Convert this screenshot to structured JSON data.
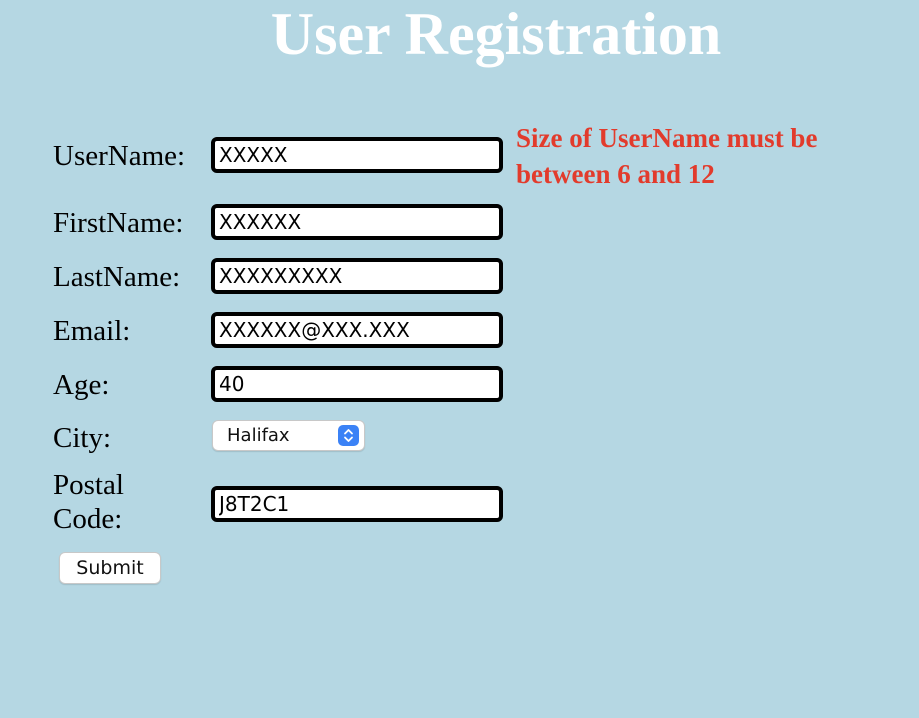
{
  "page": {
    "title": "User Registration"
  },
  "form": {
    "username": {
      "label": "UserName:",
      "value": "XXXXX"
    },
    "firstname": {
      "label": "FirstName:",
      "value": "XXXXXX"
    },
    "lastname": {
      "label": "LastName:",
      "value": "XXXXXXXXX"
    },
    "email": {
      "label": "Email:",
      "value": "XXXXXX@XXX.XXX"
    },
    "age": {
      "label": "Age:",
      "value": "40"
    },
    "city": {
      "label": "City:",
      "selected": "Halifax"
    },
    "postal": {
      "label_line1": "Postal",
      "label_line2": "Code:",
      "value": "J8T2C1"
    },
    "submit_label": "Submit"
  },
  "errors": {
    "username": "Size of UserName must be between 6 and 12"
  },
  "colors": {
    "background": "#b5d7e3",
    "title": "#ffffff",
    "error": "#e23b2c",
    "select_accent": "#3b82f6"
  },
  "icons": {
    "select_arrow": "chevron-up-down-icon"
  }
}
